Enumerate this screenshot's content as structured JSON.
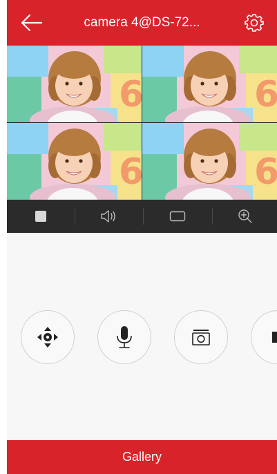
{
  "header": {
    "title": "camera 4@DS-72...",
    "back_icon": "arrow-left-icon",
    "settings_icon": "gear-icon",
    "color": "#d8232a"
  },
  "video": {
    "layout": "2x2",
    "tiles": 4
  },
  "controls": {
    "items": [
      {
        "icon": "stop-icon"
      },
      {
        "icon": "speaker-icon"
      },
      {
        "icon": "fullscreen-icon"
      },
      {
        "icon": "zoom-in-icon"
      }
    ]
  },
  "actions": {
    "items": [
      {
        "icon": "ptz-direction-icon"
      },
      {
        "icon": "microphone-icon"
      },
      {
        "icon": "camera-snapshot-icon"
      },
      {
        "icon": "record-icon"
      }
    ]
  },
  "footer": {
    "label": "Gallery"
  }
}
